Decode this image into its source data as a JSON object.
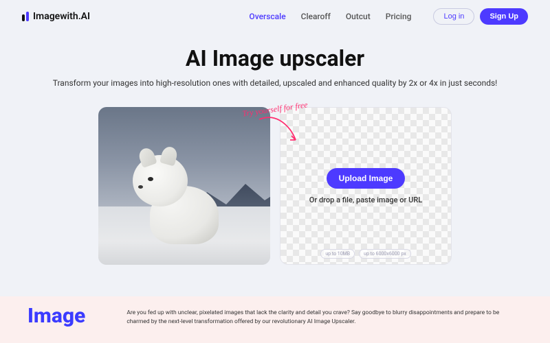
{
  "brand": {
    "name": "Imagewith.AI"
  },
  "nav": {
    "items": [
      {
        "label": "Overscale",
        "active": true
      },
      {
        "label": "Clearoff",
        "active": false
      },
      {
        "label": "Outcut",
        "active": false
      },
      {
        "label": "Pricing",
        "active": false
      }
    ],
    "login": "Log in",
    "signup": "Sign Up"
  },
  "hero": {
    "title": "AI Image upscaler",
    "subtitle": "Transform your images into high-resolution ones with detailed, upscaled and enhanced quality by 2x or 4x in just seconds!"
  },
  "callout": {
    "try_free": "Try yourself for free"
  },
  "upload": {
    "button": "Upload Image",
    "drop_text": "Or drop a file, paste image or URL",
    "limits": [
      "up to 10MB",
      "up to 6000x6000 px"
    ]
  },
  "footer": {
    "title": "Image",
    "body": "Are you fed up with unclear, pixelated images that lack the clarity and detail you crave? Say goodbye to blurry disappointments and prepare to be charmed by the next-level transformation offered by our revolutionary AI Image Upscaler."
  }
}
